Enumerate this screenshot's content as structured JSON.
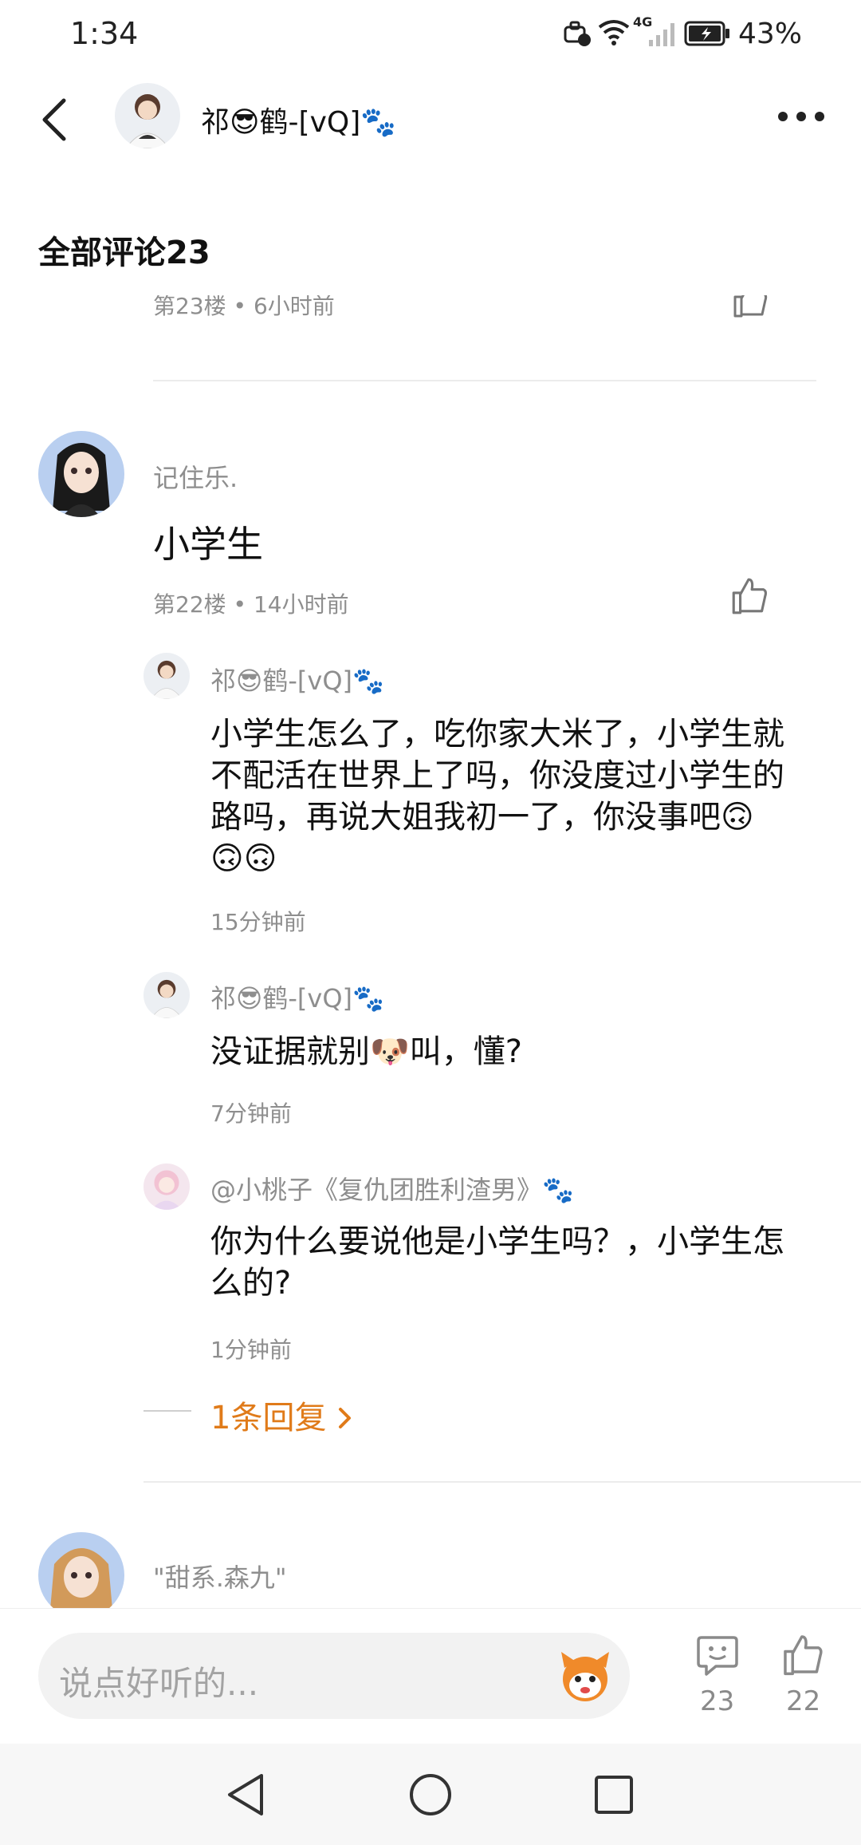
{
  "status_bar": {
    "time": "1:34",
    "battery_pct": "43%",
    "network": "4G"
  },
  "header": {
    "username": "祁😎鹤-[vQ]🐾"
  },
  "section": {
    "title": "全部评论23"
  },
  "prev_comment": {
    "meta": "第23楼 • 6小时前"
  },
  "comment": {
    "username": "记住乐.",
    "text": "小学生",
    "meta": "第22楼 • 14小时前"
  },
  "replies": [
    {
      "username": "祁😎鹤-[vQ]🐾",
      "text_lines": [
        "小学生怎么了，吃你家大米了，小学生就",
        "不配活在世界上了吗，你没度过小学生的",
        "路吗，再说大姐我初一了，你没事吧🙃",
        "🙃🙃"
      ],
      "time": "15分钟前"
    },
    {
      "username": "祁😎鹤-[vQ]🐾",
      "text_lines": [
        "没证据就别🐶叫，懂?"
      ],
      "time": "7分钟前"
    },
    {
      "username": "@小桃子《复仇团胜利渣男》🐾",
      "text_lines": [
        "你为什么要说他是小学生吗？，小学生怎",
        "么的?"
      ],
      "time": "1分钟前"
    }
  ],
  "more_replies": {
    "label": "1条回复"
  },
  "next_comment": {
    "username": "\"甜系.森九\""
  },
  "input": {
    "placeholder": "说点好听的..."
  },
  "actions": {
    "comment_count": "23",
    "like_count": "22"
  },
  "colors": {
    "accent": "#e07b1a",
    "text": "#111111",
    "muted": "#8e8e8e"
  }
}
